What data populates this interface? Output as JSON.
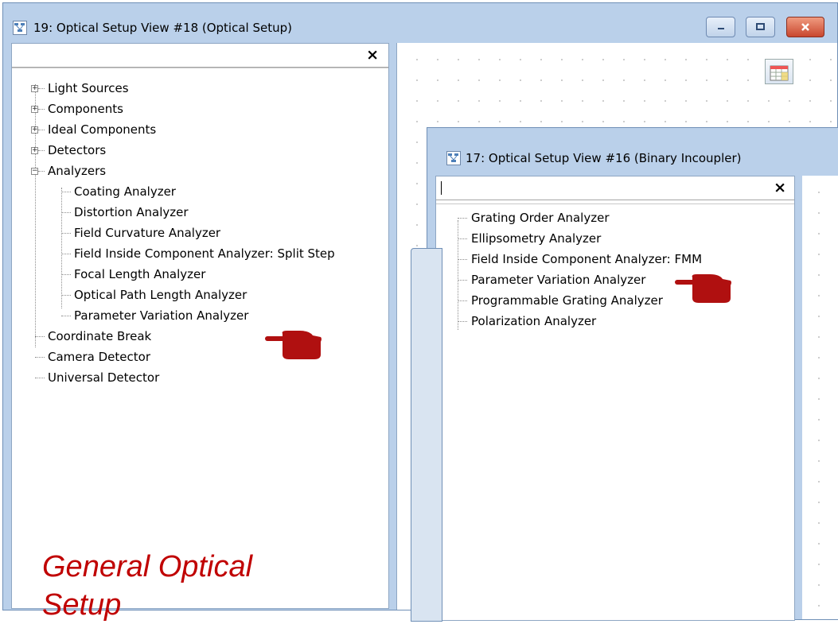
{
  "window1": {
    "title": "19: Optical Setup View #18 (Optical Setup)",
    "search": {
      "value": "",
      "placeholder": ""
    },
    "clear_label": "×",
    "tree": [
      {
        "label": "Light Sources",
        "expander": "+"
      },
      {
        "label": "Components",
        "expander": "+"
      },
      {
        "label": "Ideal Components",
        "expander": "+"
      },
      {
        "label": "Detectors",
        "expander": "+"
      },
      {
        "label": "Analyzers",
        "expander": "−"
      },
      {
        "label": "Coating Analyzer"
      },
      {
        "label": "Distortion Analyzer"
      },
      {
        "label": "Field Curvature Analyzer"
      },
      {
        "label": "Field Inside Component Analyzer: Split Step"
      },
      {
        "label": "Focal Length Analyzer"
      },
      {
        "label": "Optical Path Length Analyzer"
      },
      {
        "label": "Parameter Variation Analyzer"
      },
      {
        "label": "Coordinate Break"
      },
      {
        "label": "Camera Detector"
      },
      {
        "label": "Universal Detector"
      }
    ],
    "caption_line1": "General Optical",
    "caption_line2": "Setup"
  },
  "window2": {
    "title": "17: Optical Setup View #16 (Binary Incoupler)",
    "search": {
      "value": "",
      "placeholder": ""
    },
    "clear_label": "×",
    "tree": [
      {
        "label": "Grating Order Analyzer"
      },
      {
        "label": "Ellipsometry Analyzer"
      },
      {
        "label": "Field Inside Component Analyzer: FMM"
      },
      {
        "label": "Parameter Variation Analyzer"
      },
      {
        "label": "Programmable Grating Analyzer"
      },
      {
        "label": "Polarization Analyzer"
      }
    ]
  },
  "icons": {
    "app": "optical-setup-icon",
    "pointer": "pointing-hand-icon",
    "tool": "table-view-icon"
  },
  "colors": {
    "caption": "#c00000",
    "pointer": "#b01010",
    "titlebar": "#bad0ea"
  }
}
